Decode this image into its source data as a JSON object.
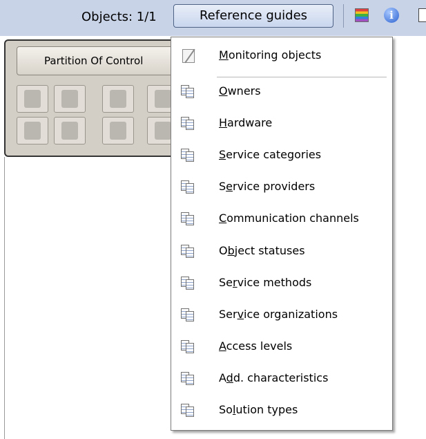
{
  "toolbar": {
    "objects_label": "Objects: 1/1",
    "reference_button": "Reference guides",
    "icons": [
      "palette-icon",
      "info-icon",
      "window-icon"
    ]
  },
  "panel": {
    "title": "Partition Of Control"
  },
  "menu": {
    "items": [
      {
        "before": "",
        "mnemonic": "M",
        "after": "onitoring objects",
        "icon": "edit-icon"
      },
      {
        "before": "",
        "mnemonic": "O",
        "after": "wners",
        "icon": "documents-icon"
      },
      {
        "before": "",
        "mnemonic": "H",
        "after": "ardware",
        "icon": "documents-icon"
      },
      {
        "before": "",
        "mnemonic": "S",
        "after": "ervice categories",
        "icon": "documents-icon"
      },
      {
        "before": "S",
        "mnemonic": "e",
        "after": "rvice providers",
        "icon": "documents-icon"
      },
      {
        "before": "",
        "mnemonic": "C",
        "after": "ommunication channels",
        "icon": "documents-icon"
      },
      {
        "before": "O",
        "mnemonic": "b",
        "after": "ject statuses",
        "icon": "documents-icon"
      },
      {
        "before": "Se",
        "mnemonic": "r",
        "after": "vice methods",
        "icon": "documents-icon"
      },
      {
        "before": "Ser",
        "mnemonic": "v",
        "after": "ice organizations",
        "icon": "documents-icon"
      },
      {
        "before": "",
        "mnemonic": "A",
        "after": "ccess levels",
        "icon": "documents-icon"
      },
      {
        "before": "A",
        "mnemonic": "d",
        "after": "d. characteristics",
        "icon": "documents-icon"
      },
      {
        "before": "So",
        "mnemonic": "l",
        "after": "ution types",
        "icon": "documents-icon"
      }
    ]
  }
}
